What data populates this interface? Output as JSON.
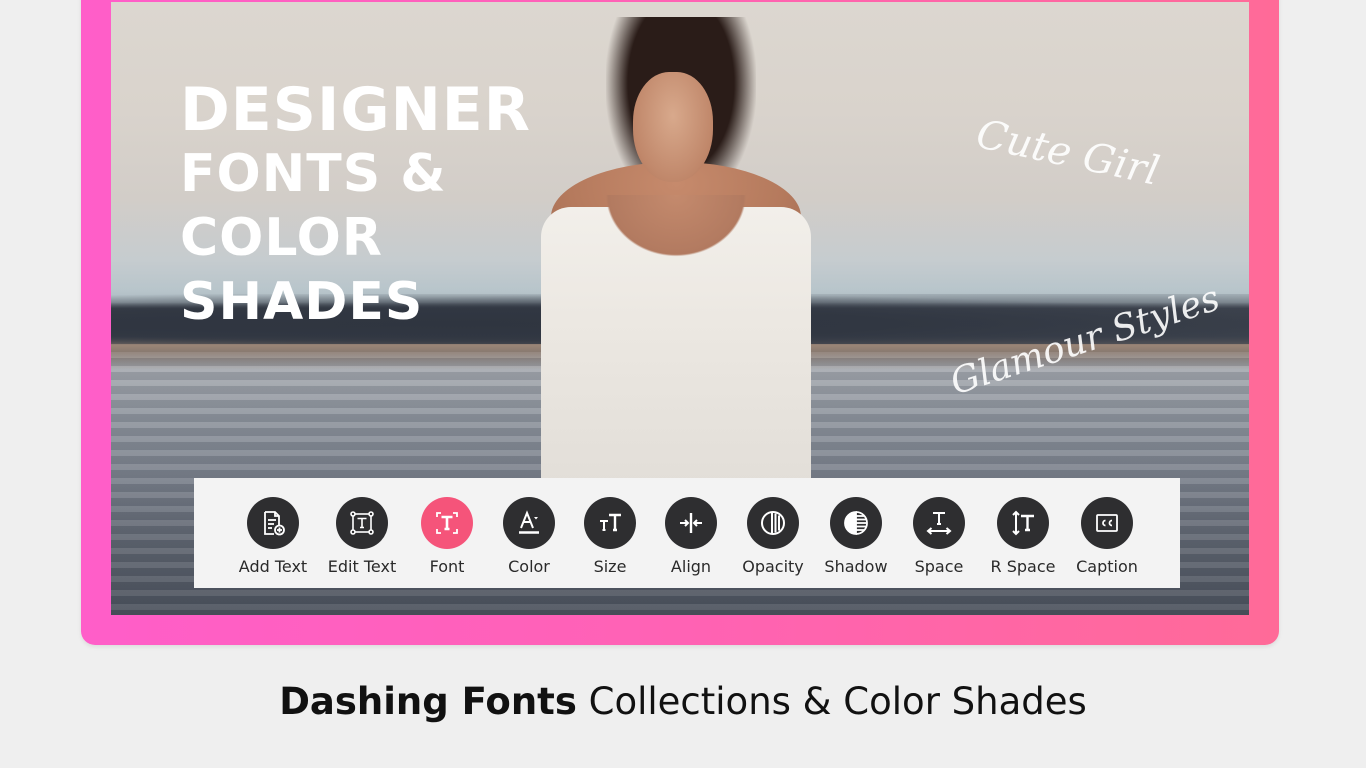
{
  "banner": {
    "heading_lines": [
      "DESIGNER",
      "FONTS &",
      "COLOR",
      "SHADES"
    ],
    "overlay_texts": [
      "Cute Girl",
      "Glamour Styles"
    ],
    "frame_color": "#ff62b4"
  },
  "toolbar": {
    "active_tool": "Font",
    "accent_color": "#f5547a",
    "icon_color": "#2e2e30",
    "tools": [
      {
        "label": "Add Text",
        "icon": "add-text-icon"
      },
      {
        "label": "Edit Text",
        "icon": "edit-text-icon"
      },
      {
        "label": "Font",
        "icon": "font-icon"
      },
      {
        "label": "Color",
        "icon": "text-color-icon"
      },
      {
        "label": "Size",
        "icon": "text-size-icon"
      },
      {
        "label": "Align",
        "icon": "align-icon"
      },
      {
        "label": "Opacity",
        "icon": "opacity-icon"
      },
      {
        "label": "Shadow",
        "icon": "shadow-icon"
      },
      {
        "label": "Space",
        "icon": "letter-space-icon"
      },
      {
        "label": "R Space",
        "icon": "line-space-icon"
      },
      {
        "label": "Caption",
        "icon": "caption-icon"
      }
    ]
  },
  "caption": {
    "bold": "Dashing Fonts",
    "regular": " Collections & Color Shades"
  }
}
